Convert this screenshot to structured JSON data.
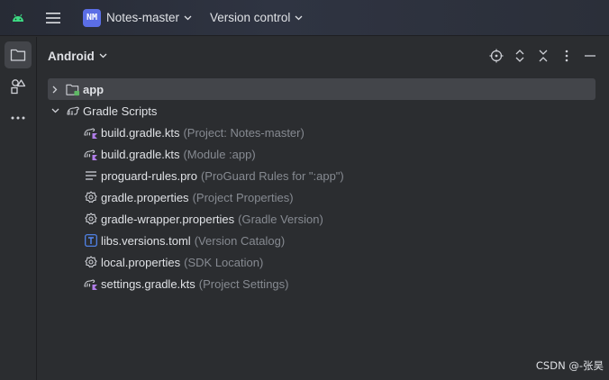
{
  "titlebar": {
    "android_icon": "android-icon",
    "menu_icon": "hamburger-menu-icon",
    "project_badge": "NM",
    "project_name": "Notes-master",
    "vcs_label": "Version control"
  },
  "stripe": {
    "items": [
      {
        "icon": "project-folder-icon",
        "active": true
      },
      {
        "icon": "resource-manager-icon",
        "active": false
      },
      {
        "icon": "more-horizontal-icon",
        "active": false
      }
    ]
  },
  "panel": {
    "view_mode": "Android",
    "actions": [
      "locate-crosshair-icon",
      "expand-all-icon",
      "collapse-all-icon",
      "more-vertical-icon",
      "minimize-icon"
    ]
  },
  "tree": {
    "app": {
      "name": "app"
    },
    "gradle_scripts": {
      "name": "Gradle Scripts"
    },
    "files": [
      {
        "name": "build.gradle.kts",
        "hint": "(Project: Notes-master)",
        "icon": "gradle-kts-icon"
      },
      {
        "name": "build.gradle.kts",
        "hint": "(Module :app)",
        "icon": "gradle-kts-icon"
      },
      {
        "name": "proguard-rules.pro",
        "hint": "(ProGuard Rules for \":app\")",
        "icon": "text-lines-icon"
      },
      {
        "name": "gradle.properties",
        "hint": "(Project Properties)",
        "icon": "settings-gear-icon"
      },
      {
        "name": "gradle-wrapper.properties",
        "hint": "(Gradle Version)",
        "icon": "settings-gear-icon"
      },
      {
        "name": "libs.versions.toml",
        "hint": "(Version Catalog)",
        "icon": "toml-icon"
      },
      {
        "name": "local.properties",
        "hint": "(SDK Location)",
        "icon": "settings-gear-icon"
      },
      {
        "name": "settings.gradle.kts",
        "hint": "(Project Settings)",
        "icon": "gradle-kts-icon"
      }
    ]
  },
  "watermark": "CSDN @-张昊"
}
